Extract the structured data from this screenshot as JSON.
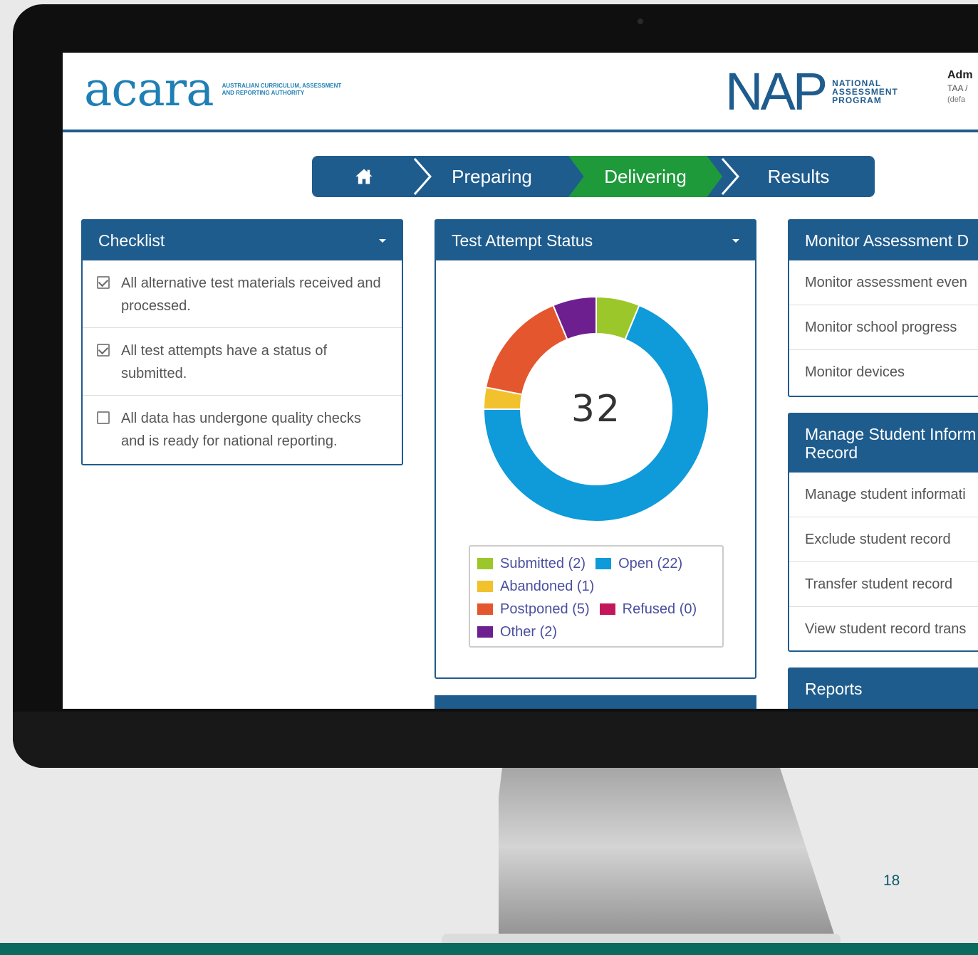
{
  "header": {
    "acara_word": "acara",
    "acara_sub": "Australian Curriculum, Assessment and Reporting Authority",
    "nap_word": "NAP",
    "nap_sub": [
      "NATIONAL",
      "ASSESSMENT",
      "PROGRAM"
    ],
    "user_name": "Adm",
    "user_org": "TAA /",
    "user_note": "(defa"
  },
  "nav": {
    "steps": [
      {
        "label": "",
        "icon": "home-icon"
      },
      {
        "label": "Preparing"
      },
      {
        "label": "Delivering",
        "active": true
      },
      {
        "label": "Results"
      }
    ],
    "colors": {
      "default": "#1f5c8e",
      "active": "#1e9a3b"
    }
  },
  "checklist": {
    "title": "Checklist",
    "items": [
      {
        "text": "All alternative test materials received and processed.",
        "checked": true
      },
      {
        "text": "All test attempts have a status of submitted.",
        "checked": true
      },
      {
        "text": "All data has undergone quality checks and is ready for national reporting.",
        "checked": false
      }
    ]
  },
  "status": {
    "title": "Test Attempt Status",
    "total": "32",
    "legend": [
      {
        "label": "Submitted (2)",
        "color": "#9cc72a"
      },
      {
        "label": "Open (22)",
        "color": "#0f9ad9"
      },
      {
        "label": "Abandoned (1)",
        "color": "#f2c12e"
      },
      {
        "label": "Postponed (5)",
        "color": "#e4572e"
      },
      {
        "label": "Refused (0)",
        "color": "#c2185b"
      },
      {
        "label": "Other (2)",
        "color": "#6d1f8f"
      }
    ]
  },
  "chart_data": {
    "type": "pie",
    "categories": [
      "Submitted",
      "Open",
      "Abandoned",
      "Postponed",
      "Refused",
      "Other"
    ],
    "values": [
      2,
      22,
      1,
      5,
      0,
      2
    ],
    "colors": [
      "#9cc72a",
      "#0f9ad9",
      "#f2c12e",
      "#e4572e",
      "#c2185b",
      "#6d1f8f"
    ],
    "center_label": "32",
    "donut": true
  },
  "monitor": {
    "title": "Monitor Assessment D",
    "items": [
      "Monitor assessment even",
      "Monitor school progress",
      "Monitor devices"
    ]
  },
  "manage": {
    "title": "Manage Student Inform Record",
    "items": [
      "Manage student informati",
      "Exclude student record",
      "Transfer student record",
      "View student record trans"
    ]
  },
  "reports": {
    "title": "Reports"
  },
  "slide": {
    "page_number": "18"
  }
}
